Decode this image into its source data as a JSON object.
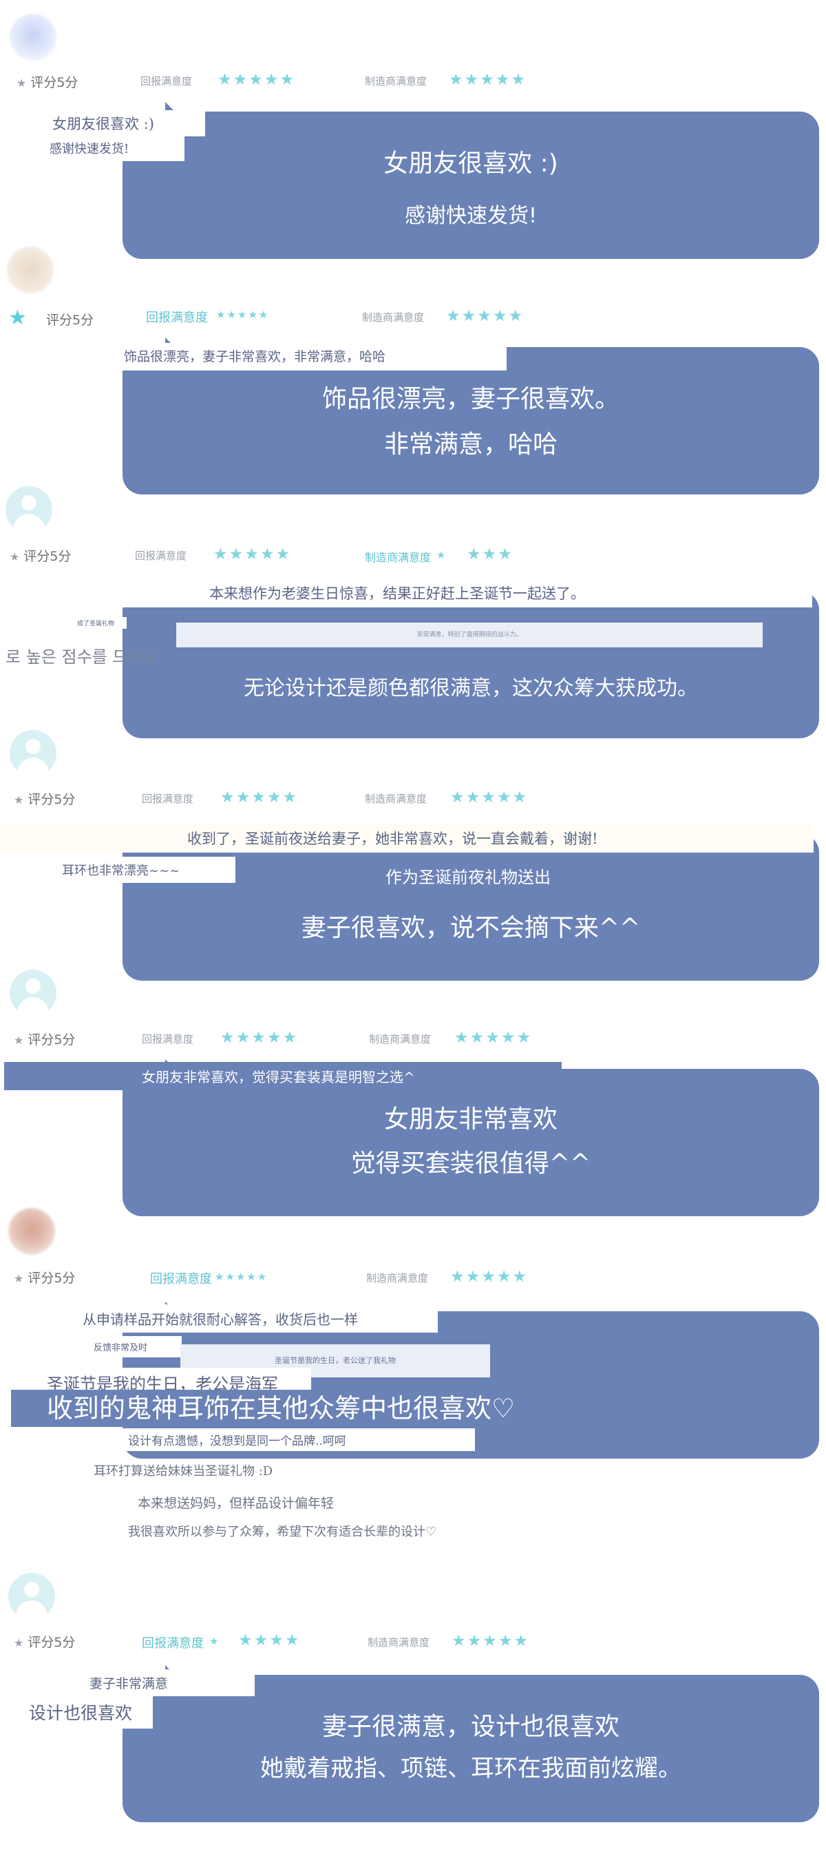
{
  "colors": {
    "bubble": "#6a82b6",
    "star": "#7fd6df",
    "teal": "#5fc3cf"
  },
  "reviews": [
    {
      "rating_text": "评分5分",
      "return_label": "回报满意度",
      "return_stars": "★★★★★",
      "maker_label": "制造商满意度",
      "maker_stars": "★★★★★",
      "overlay": [
        "女朋友很喜欢 :)",
        "感谢快速发货!"
      ],
      "bubble": [
        "女朋友很喜欢 :)",
        "感谢快速发货!"
      ]
    },
    {
      "rating_text": "评分5分",
      "return_label": "回报满意度",
      "return_stars": "★★★★★",
      "maker_label": "制造商满意度",
      "maker_stars": "★★★★★",
      "overlay": [
        "饰品很漂亮，妻子非常喜欢，非常满意，哈哈"
      ],
      "bubble": [
        "饰品很漂亮，妻子很喜欢。",
        "非常满意，哈哈"
      ]
    },
    {
      "rating_text": "评分5分",
      "return_label": "回报满意度",
      "return_stars": "★★★★★",
      "maker_label": "制造商满意度",
      "maker_stars_a": "★",
      "maker_stars_b": "★★★",
      "overlay": [
        "本来想作为老婆生日惊喜，结果正好赶上圣诞节一起送了。",
        "成了圣诞礼物",
        "非常满意，特别了值得期待的战斗力。",
        "로 높은 점수를 드려요"
      ],
      "bubble": [
        "无论设计还是颜色都很满意，这次众筹大获成功。"
      ]
    },
    {
      "rating_text": "评分5分",
      "return_label": "回报满意度",
      "return_stars": "★★★★★",
      "maker_label": "制造商满意度",
      "maker_stars": "★★★★★",
      "overlay": [
        "收到了，圣诞前夜送给妻子，她非常喜欢，说一直会戴着，谢谢!",
        "耳环也非常漂亮~~~",
        "作为圣诞前夜礼物送出"
      ],
      "bubble": [
        "妻子很喜欢，说不会摘下来^^"
      ]
    },
    {
      "rating_text": "评分5分",
      "return_label": "回报满意度",
      "return_stars": "★★★★★",
      "maker_label": "制造商满意度",
      "maker_stars": "★★★★★",
      "overlay": [
        "女朋友非常喜欢，觉得买套装真是明智之选^"
      ],
      "bubble": [
        "女朋友非常喜欢",
        "觉得买套装很值得^^"
      ]
    },
    {
      "rating_text": "评分5分",
      "return_label": "回报满意度",
      "return_stars": "★★★★★",
      "maker_label": "制造商满意度",
      "maker_stars": "★★★★★",
      "overlay": [
        "从申请样品开始就很耐心解答，收货后也一样",
        "反馈非常及时",
        "圣诞节是我的生日，老公送了我礼物",
        "圣诞节是我的生日，老公是海军",
        "收到的鬼神耳饰在其他众筹中也很喜欢♡",
        "设计有点遗憾，没想到是同一个品牌..呵呵",
        "耳环打算送给妹妹当圣诞礼物 :D",
        "本来想送妈妈，但样品设计偏年轻",
        "我很喜欢所以参与了众筹，希望下次有适合长辈的设计♡"
      ]
    },
    {
      "rating_text": "评分5分",
      "return_label": "回报满意度",
      "return_stars_a": "★",
      "return_stars_b": "★★★★",
      "maker_label": "制造商满意度",
      "maker_stars": "★★★★★",
      "overlay": [
        "妻子非常满意",
        "设计也很喜欢"
      ],
      "bubble": [
        "妻子很满意，设计也很喜欢",
        "她戴着戒指、项链、耳环在我面前炫耀。"
      ]
    }
  ]
}
